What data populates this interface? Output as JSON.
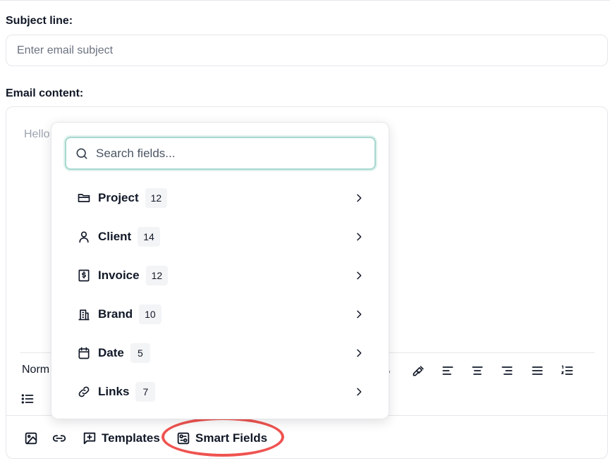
{
  "subject": {
    "label": "Subject line:",
    "placeholder": "Enter email subject"
  },
  "content": {
    "label": "Email content:",
    "placeholder": "Hello",
    "style_select": "Norm"
  },
  "toolbar": {
    "bottom": {
      "templates_label": "Templates",
      "smart_fields_label": "Smart Fields"
    }
  },
  "smart_fields_menu": {
    "search_placeholder": "Search fields...",
    "items": [
      {
        "label": "Project",
        "count": "12",
        "icon": "folder-icon"
      },
      {
        "label": "Client",
        "count": "14",
        "icon": "user-icon"
      },
      {
        "label": "Invoice",
        "count": "12",
        "icon": "receipt-dollar-icon"
      },
      {
        "label": "Brand",
        "count": "10",
        "icon": "building-icon"
      },
      {
        "label": "Date",
        "count": "5",
        "icon": "calendar-icon"
      },
      {
        "label": "Links",
        "count": "7",
        "icon": "link-icon"
      }
    ]
  },
  "colors": {
    "highlight_ring": "#ef5350",
    "search_focus": "#a7d8cf"
  }
}
